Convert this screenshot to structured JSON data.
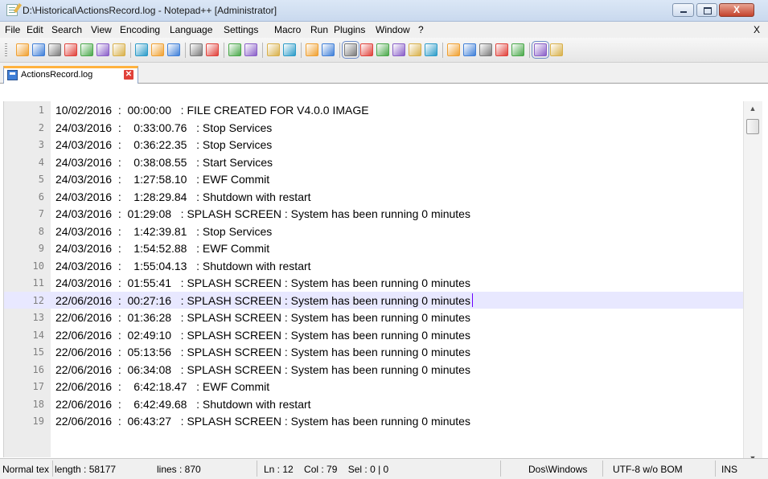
{
  "window": {
    "title": "D:\\Historical\\ActionsRecord.log - Notepad++ [Administrator]",
    "close_glyph": "X"
  },
  "menu": {
    "items": [
      "File",
      "Edit",
      "Search",
      "View",
      "Encoding",
      "Language",
      "Settings",
      "Macro",
      "Run",
      "Plugins",
      "Window",
      "?"
    ],
    "close_doc": "X"
  },
  "toolbar": {
    "icons": [
      "new-file-icon",
      "open-file-icon",
      "save-icon",
      "save-all-icon",
      "close-icon",
      "close-all-icon",
      "print-icon",
      "cut-icon",
      "copy-icon",
      "paste-icon",
      "undo-icon",
      "redo-icon",
      "find-icon",
      "replace-icon",
      "zoom-in-icon",
      "zoom-out-icon",
      "sync-vertical-icon",
      "sync-horizontal-icon",
      "word-wrap-icon",
      "show-all-chars-icon",
      "indent-guide-icon",
      "doc-map-icon",
      "function-list-icon",
      "folder-workspace-icon",
      "macro-record-icon",
      "macro-stop-icon",
      "macro-play-icon",
      "macro-run-multiple-icon",
      "macro-save-icon",
      "spell-check-icon",
      "plugin-icon"
    ]
  },
  "tab": {
    "label": "ActionsRecord.log",
    "close_glyph": "✕"
  },
  "editor": {
    "current_line": 12,
    "lines": [
      {
        "n": "1",
        "text": "10/02/2016  :  00:00:00   : FILE CREATED FOR V4.0.0 IMAGE"
      },
      {
        "n": "2",
        "text": "24/03/2016  :    0:33:00.76   : Stop Services"
      },
      {
        "n": "3",
        "text": "24/03/2016  :    0:36:22.35   : Stop Services"
      },
      {
        "n": "4",
        "text": "24/03/2016  :    0:38:08.55   : Start Services"
      },
      {
        "n": "5",
        "text": "24/03/2016  :    1:27:58.10   : EWF Commit"
      },
      {
        "n": "6",
        "text": "24/03/2016  :    1:28:29.84   : Shutdown with restart"
      },
      {
        "n": "7",
        "text": "24/03/2016  :  01:29:08   : SPLASH SCREEN : System has been running 0 minutes"
      },
      {
        "n": "8",
        "text": "24/03/2016  :    1:42:39.81   : Stop Services"
      },
      {
        "n": "9",
        "text": "24/03/2016  :    1:54:52.88   : EWF Commit"
      },
      {
        "n": "10",
        "text": "24/03/2016  :    1:55:04.13   : Shutdown with restart"
      },
      {
        "n": "11",
        "text": "24/03/2016  :  01:55:41   : SPLASH SCREEN : System has been running 0 minutes"
      },
      {
        "n": "12",
        "text": "22/06/2016  :  00:27:16   : SPLASH SCREEN : System has been running 0 minutes"
      },
      {
        "n": "13",
        "text": "22/06/2016  :  01:36:28   : SPLASH SCREEN : System has been running 0 minutes"
      },
      {
        "n": "14",
        "text": "22/06/2016  :  02:49:10   : SPLASH SCREEN : System has been running 0 minutes"
      },
      {
        "n": "15",
        "text": "22/06/2016  :  05:13:56   : SPLASH SCREEN : System has been running 0 minutes"
      },
      {
        "n": "16",
        "text": "22/06/2016  :  06:34:08   : SPLASH SCREEN : System has been running 0 minutes"
      },
      {
        "n": "17",
        "text": "22/06/2016  :    6:42:18.47   : EWF Commit"
      },
      {
        "n": "18",
        "text": "22/06/2016  :    6:42:49.68   : Shutdown with restart"
      },
      {
        "n": "19",
        "text": "22/06/2016  :  06:43:27   : SPLASH SCREEN : System has been running 0 minutes"
      }
    ]
  },
  "status": {
    "type": "Normal tex",
    "length": "length : 58177",
    "lines": "lines : 870",
    "position": "Ln : 12    Col : 79    Sel : 0 | 0",
    "eol": "Dos\\Windows",
    "encoding": "UTF-8 w/o BOM",
    "mode": "INS"
  }
}
